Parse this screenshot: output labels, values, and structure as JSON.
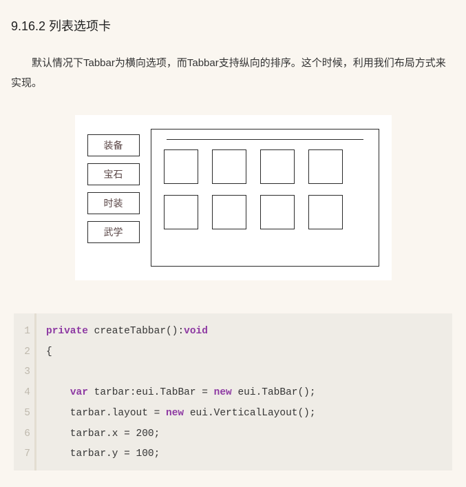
{
  "heading": "9.16.2 列表选项卡",
  "paragraph": "默认情况下Tabbar为横向选项，而Tabbar支持纵向的排序。这个时候，利用我们布局方式来实现。",
  "tabs": [
    "装备",
    "宝石",
    "时装",
    "武学"
  ],
  "code": {
    "line_numbers": [
      "1",
      "2",
      "3",
      "4",
      "5",
      "6",
      "7"
    ],
    "tokens": [
      [
        {
          "t": "private",
          "c": "kw"
        },
        {
          "t": " createTabbar():"
        },
        {
          "t": "void",
          "c": "kw"
        }
      ],
      [
        {
          "t": "{"
        }
      ],
      [
        {
          "t": ""
        }
      ],
      [
        {
          "t": "    "
        },
        {
          "t": "var",
          "c": "kw"
        },
        {
          "t": " tarbar:eui.TabBar = "
        },
        {
          "t": "new",
          "c": "nw"
        },
        {
          "t": " eui.TabBar();"
        }
      ],
      [
        {
          "t": "    tarbar.layout = "
        },
        {
          "t": "new",
          "c": "nw"
        },
        {
          "t": " eui.VerticalLayout();"
        }
      ],
      [
        {
          "t": "    tarbar.x = 200;"
        }
      ],
      [
        {
          "t": "    tarbar.y = 100;"
        }
      ]
    ]
  }
}
